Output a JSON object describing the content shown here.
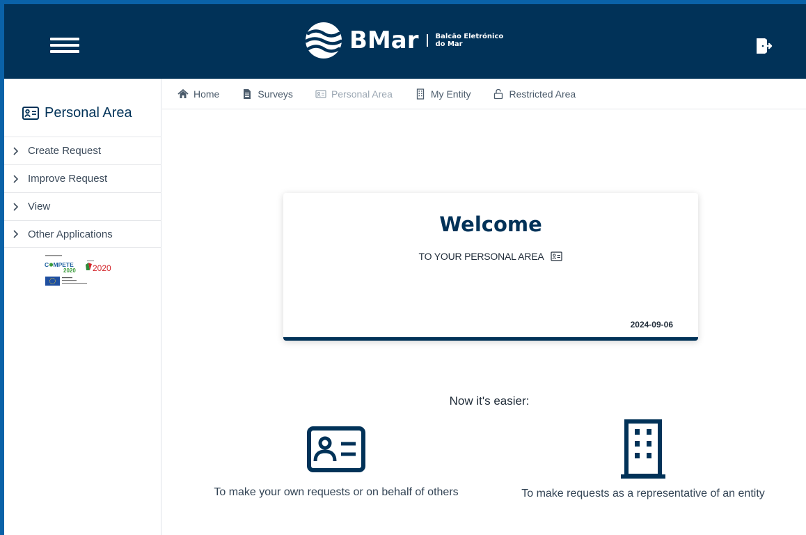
{
  "header": {
    "logo_name": "BMar",
    "logo_sub_line1": "Balcão Eletrónico",
    "logo_sub_line2": "do Mar",
    "menu_icon": "hamburger-icon",
    "logout_icon": "logout-icon"
  },
  "sidebar": {
    "title": "Personal Area",
    "title_icon": "id-card-icon",
    "items": [
      {
        "label": "Create Request"
      },
      {
        "label": "Improve Request"
      },
      {
        "label": "View"
      },
      {
        "label": "Other Applications"
      }
    ]
  },
  "nav": {
    "items": [
      {
        "label": "Home",
        "icon": "home-icon"
      },
      {
        "label": "Surveys",
        "icon": "document-icon"
      },
      {
        "label": "Personal Area",
        "icon": "id-card-icon",
        "active": true
      },
      {
        "label": "My Entity",
        "icon": "building-icon"
      },
      {
        "label": "Restricted Area",
        "icon": "lock-icon"
      }
    ]
  },
  "card": {
    "title": "Welcome",
    "subtitle": "TO YOUR PERSONAL AREA",
    "date": "2024-09-06"
  },
  "easier": "Now it's easier:",
  "features": [
    {
      "text": "To make your own requests or on behalf of others",
      "icon": "id-card-icon"
    },
    {
      "text": "To make requests as a representative of an entity",
      "icon": "building-icon"
    }
  ],
  "colors": {
    "brand_navy": "#013258",
    "frame_blue": "#0a62a8"
  }
}
